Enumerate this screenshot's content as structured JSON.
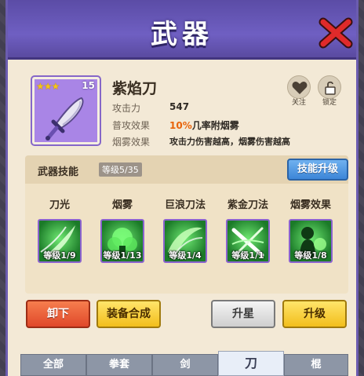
{
  "header": {
    "title": "武器"
  },
  "weapon": {
    "name": "紫焰刀",
    "level": "15",
    "stars": "★★★",
    "attack_label": "攻击力",
    "attack_value": "547",
    "normal_effect_label": "普攻效果",
    "normal_effect_pct": "10%",
    "normal_effect_text": "几率附烟雾",
    "smoke_effect_label": "烟雾效果",
    "smoke_effect_text": "攻击力伤害越高，烟雾伤害越高"
  },
  "actions": {
    "favorite_label": "关注",
    "lock_label": "锁定"
  },
  "skills": {
    "title": "武器技能",
    "level": "等级5/35",
    "upgrade_label": "技能升级",
    "items": [
      {
        "name": "刀光",
        "level": "等级1/9"
      },
      {
        "name": "烟雾",
        "level": "等级1/13"
      },
      {
        "name": "巨浪刀法",
        "level": "等级1/4"
      },
      {
        "name": "紫金刀法",
        "level": "等级1/1"
      },
      {
        "name": "烟雾效果",
        "level": "等级1/8"
      }
    ]
  },
  "buttons": {
    "unequip": "卸下",
    "synthesize": "装备合成",
    "star_up": "升星",
    "upgrade": "升级"
  },
  "tabs": [
    "全部",
    "拳套",
    "剑",
    "刀",
    "棍"
  ],
  "active_tab": "刀",
  "colors": {
    "accent_purple": "#6f5fc2",
    "highlight_orange": "#e8630a",
    "skill_green": "#1b7a28"
  }
}
